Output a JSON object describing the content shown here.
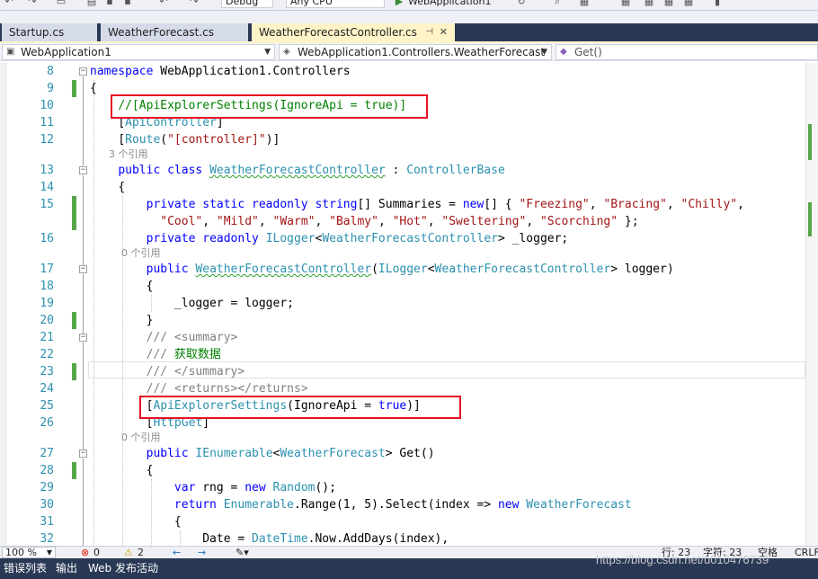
{
  "toolbar": {
    "config": "Debug",
    "platform": "Any CPU",
    "run_target": "WebApplication1"
  },
  "tabs": [
    {
      "label": "Startup.cs",
      "active": false
    },
    {
      "label": "WeatherForecast.cs",
      "active": false
    },
    {
      "label": "WeatherForecastController.cs",
      "active": true
    }
  ],
  "nav": {
    "project": "WebApplication1",
    "type": "WebApplication1.Controllers.WeatherForecast",
    "member": "Get()"
  },
  "code": {
    "line_numbers": [
      "8",
      "9",
      "10",
      "11",
      "12",
      "13",
      "14",
      "15",
      "16",
      "17",
      "18",
      "19",
      "20",
      "21",
      "22",
      "23",
      "24",
      "25",
      "26",
      "27",
      "28",
      "29",
      "30",
      "31",
      "32"
    ],
    "ns_kw": "namespace",
    "ns_name": " WebApplication1.Controllers",
    "brace_open": "{",
    "brace_close": "}",
    "commented_attr": "//[ApiExplorerSettings(IgnoreApi = true)]",
    "lb": "[",
    "rb": "]",
    "api_controller": "ApiController",
    "route": "Route",
    "route_open": "(",
    "route_str": "\"[controller]\"",
    "route_close": ")",
    "refs_3": "3 个引用",
    "public_class": "public class",
    "class_name": "WeatherForecastController",
    "colon": " : ",
    "base_class": "ControllerBase",
    "private_static_readonly": "private static readonly",
    "string_kw": "string",
    "summ_decl": "[] Summaries = ",
    "new_kw": "new",
    "arr_open": "[] { ",
    "arr_close": " };",
    "strings_line1": [
      "\"Freezing\"",
      "\"Bracing\"",
      "\"Chilly\""
    ],
    "strings_line2": [
      "\"Cool\"",
      "\"Mild\"",
      "\"Warm\"",
      "\"Balmy\"",
      "\"Hot\"",
      "\"Sweltering\"",
      "\"Scorching\""
    ],
    "comma": ", ",
    "private_readonly": "private readonly",
    "ilogger": "ILogger",
    "lt": "<",
    "gt": ">",
    "logger_field": " _logger;",
    "refs_0": "0 个引用",
    "public_kw": "public",
    "ctor_open": "(",
    "ctor_param": " logger)",
    "assign": "_logger = logger;",
    "doc_prefix": "///",
    "summary_open": " <summary>",
    "summary_text": " 获取数据",
    "summary_close": " </summary>",
    "returns_tag": " <returns></returns>",
    "attr_name": "ApiExplorerSettings",
    "attr_args": "(IgnoreApi = ",
    "true_kw": "true",
    "attr_end": ")]",
    "http_get": "HttpGet",
    "ienumerable": "IEnumerable",
    "model": "WeatherForecast",
    "get_name": " Get()",
    "var_kw": "var",
    "rng_decl": " rng = ",
    "random": "Random",
    "parens_semi": "();",
    "return_kw": "return",
    "enumerable": "Enumerable",
    "range_call": ".Range(1, 5).Select(index => ",
    "date_lhs": "Date = ",
    "datetime": "DateTime",
    "date_rhs": ".Now.AddDays(index),"
  },
  "status": {
    "zoom": "100 %",
    "errors": "0",
    "warnings": "2",
    "line": "行: 23",
    "char": "字符: 23",
    "mode": "空格",
    "eol": "CRLF"
  },
  "bottom_tabs": [
    "错误列表",
    "输出",
    "Web 发布活动"
  ],
  "watermark": "https://blog.csdn.net/u010476739",
  "colors": {
    "keyword": "#0000ff",
    "type": "#2b91af",
    "string": "#a31515",
    "comment": "#008000",
    "highlight_box": "#e81123",
    "tab_active": "#fff3c8",
    "chrome_dark": "#293955"
  }
}
